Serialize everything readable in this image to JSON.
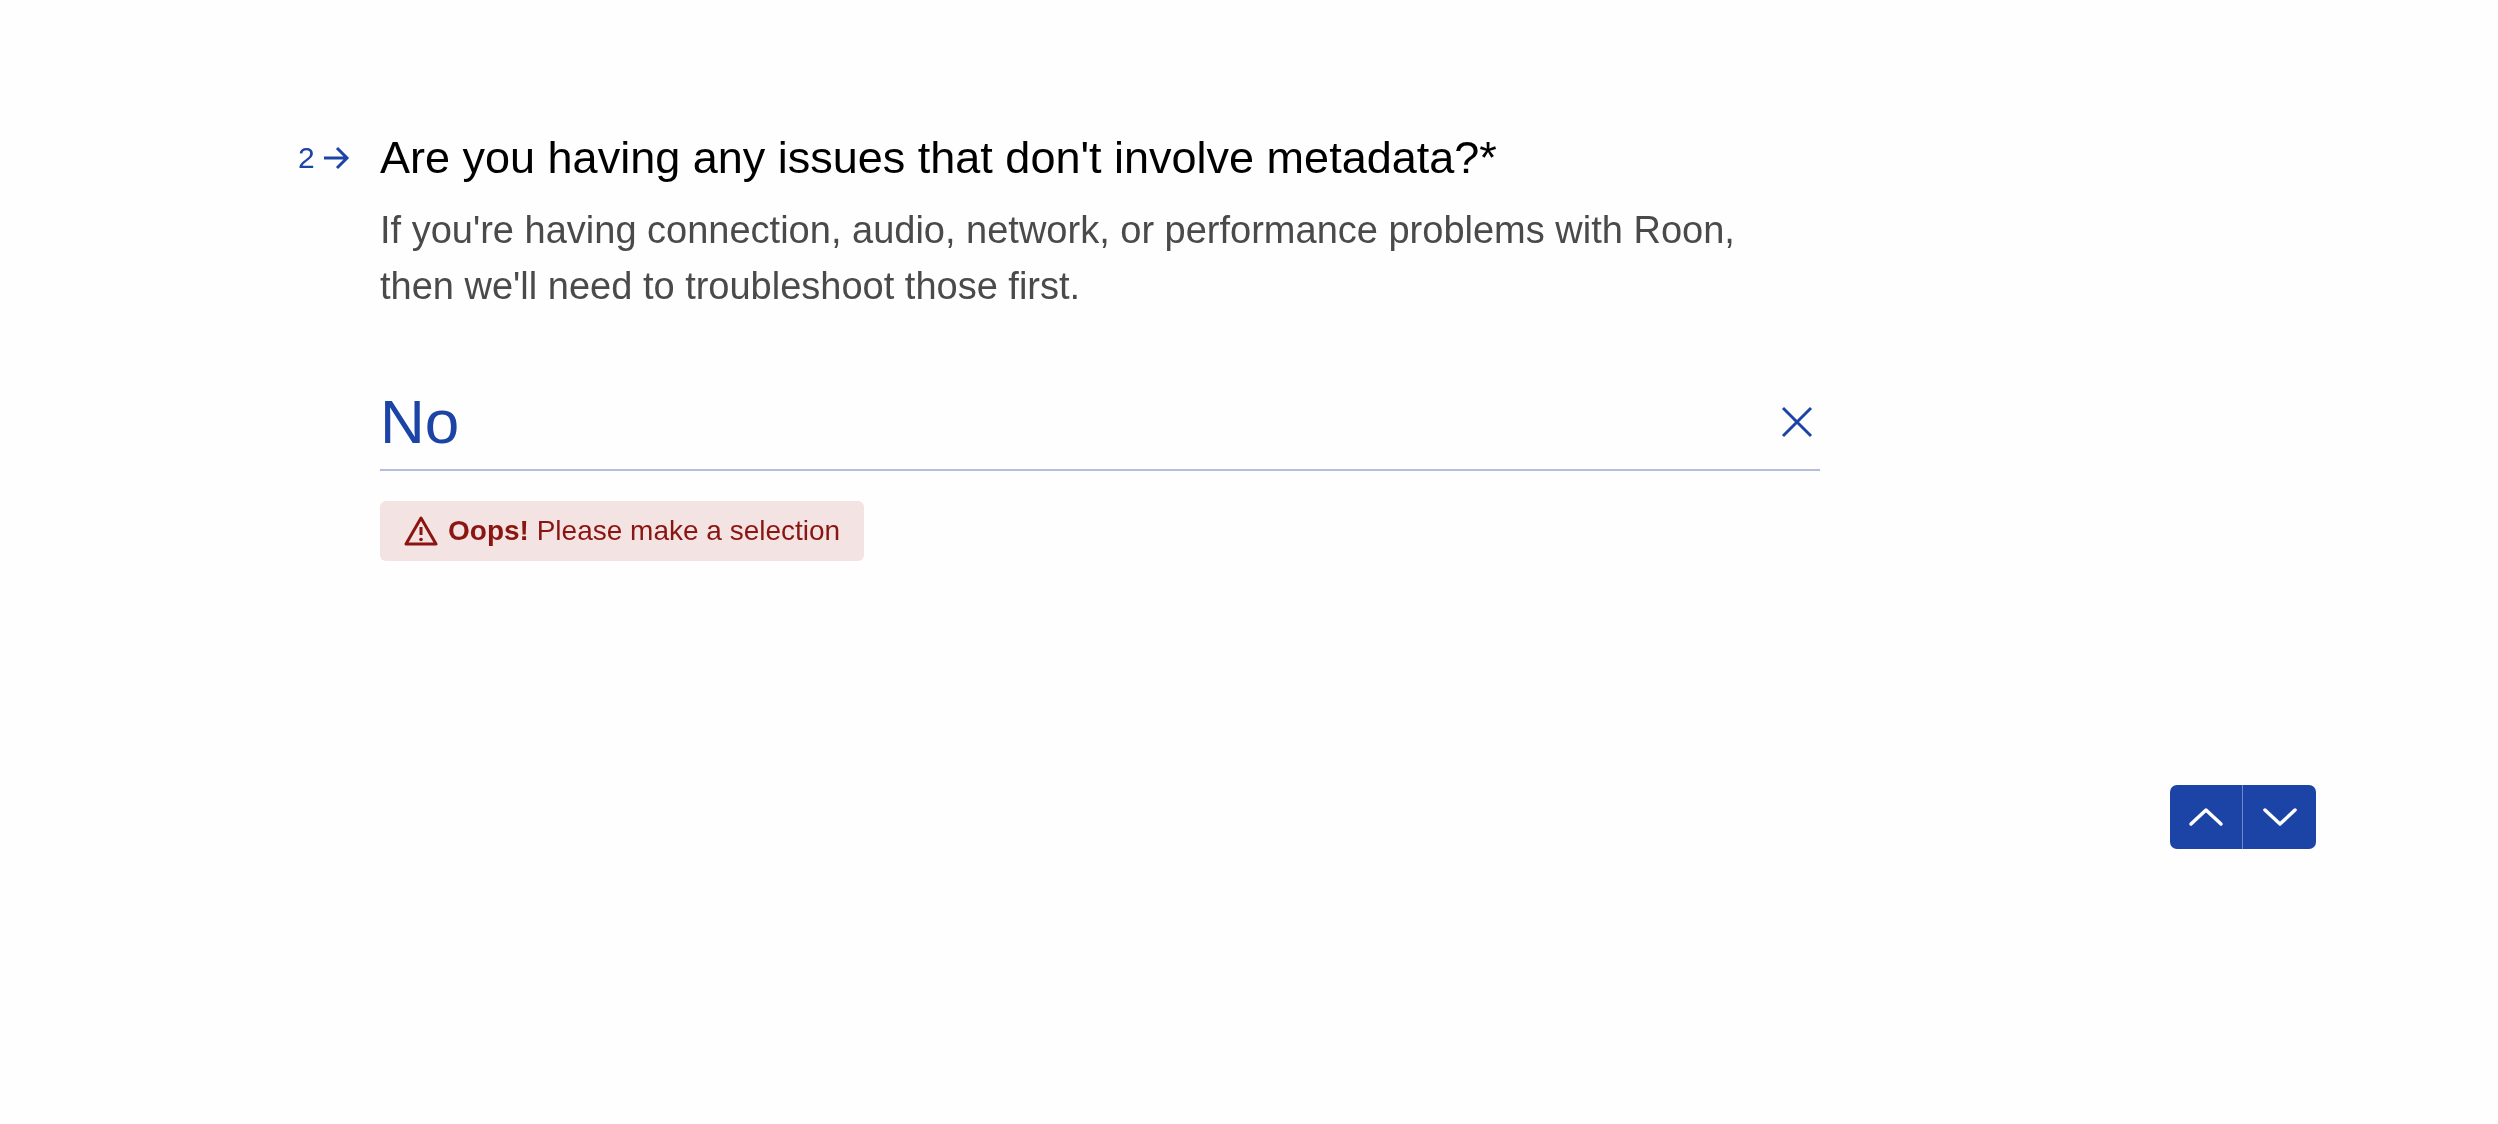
{
  "question": {
    "number": "2",
    "title": "Are you having any issues that don't involve metadata?*",
    "description": "If you're having connection, audio, network, or performance problems with Roon, then we'll need to troubleshoot those first.",
    "answer": {
      "value": "No"
    },
    "error": "**Oops!** Please make a selection"
  }
}
